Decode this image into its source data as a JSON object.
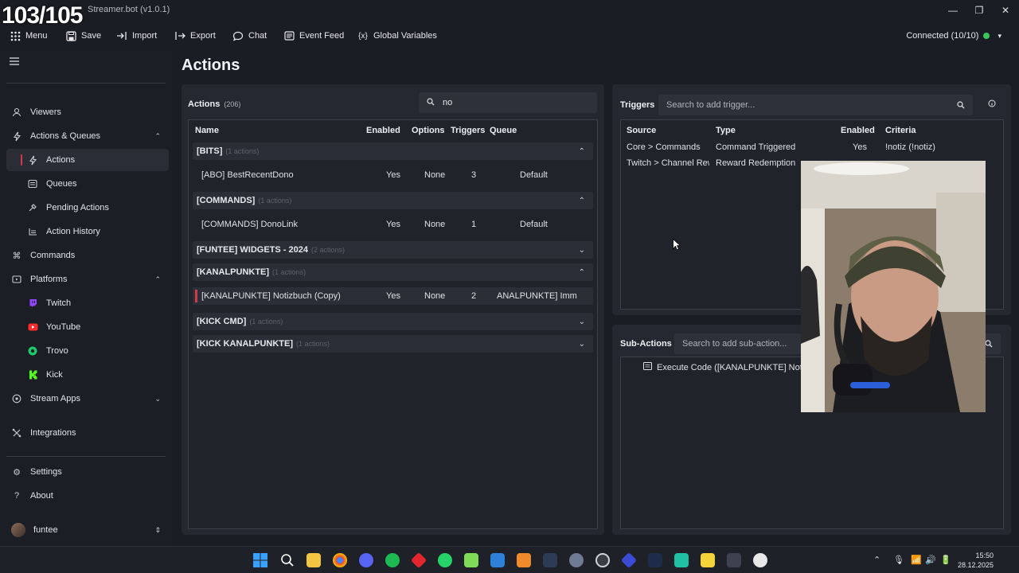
{
  "overlay_counter": "103/105",
  "window": {
    "title": "Streamer.bot (v1.0.1)",
    "minimize": "—",
    "maximize": "❐",
    "close": "✕"
  },
  "menubar": {
    "items": [
      {
        "label": "Menu",
        "icon": "grid-icon"
      },
      {
        "label": "Save",
        "icon": "save-icon"
      },
      {
        "label": "Import",
        "icon": "import-icon"
      },
      {
        "label": "Export",
        "icon": "export-icon"
      },
      {
        "label": "Chat",
        "icon": "chat-icon"
      },
      {
        "label": "Event Feed",
        "icon": "feed-icon"
      },
      {
        "label": "Global Variables",
        "icon": "variables-icon"
      }
    ],
    "connection": "Connected (10/10)",
    "status_color": "#3ac55b"
  },
  "sidebar": {
    "items": [
      {
        "label": "Viewers"
      },
      {
        "label": "Actions & Queues"
      },
      {
        "label": "Actions"
      },
      {
        "label": "Queues"
      },
      {
        "label": "Pending Actions"
      },
      {
        "label": "Action History"
      },
      {
        "label": "Commands"
      },
      {
        "label": "Platforms"
      },
      {
        "label": "Twitch"
      },
      {
        "label": "YouTube"
      },
      {
        "label": "Trovo"
      },
      {
        "label": "Kick"
      },
      {
        "label": "Stream Apps"
      },
      {
        "label": "Integrations"
      },
      {
        "label": "Settings"
      },
      {
        "label": "About"
      }
    ],
    "user": "funtee"
  },
  "page_title": "Actions",
  "actions_panel": {
    "title": "Actions",
    "count": "(206)",
    "search_value": "no",
    "columns": [
      "Name",
      "Enabled",
      "Options",
      "Triggers",
      "Queue"
    ],
    "groups": [
      {
        "name": "[BITS]",
        "count": "(1 actions)",
        "rows": [
          {
            "name": "[ABO] BestRecentDono",
            "enabled": "Yes",
            "options": "None",
            "triggers": "3",
            "queue": "Default"
          }
        ]
      },
      {
        "name": "[COMMANDS]",
        "count": "(1 actions)",
        "rows": [
          {
            "name": "[COMMANDS] DonoLink",
            "enabled": "Yes",
            "options": "None",
            "triggers": "1",
            "queue": "Default"
          }
        ]
      },
      {
        "name": "[FUNTEE] WIDGETS - 2024",
        "count": "(2 actions)",
        "rows": []
      },
      {
        "name": "[KANALPUNKTE]",
        "count": "(1 actions)",
        "rows": [
          {
            "name": "[KANALPUNKTE] Notizbuch (Copy)",
            "enabled": "Yes",
            "options": "None",
            "triggers": "2",
            "queue": "ANALPUNKTE] Imm"
          }
        ]
      },
      {
        "name": "[KICK CMD]",
        "count": "(1 actions)",
        "rows": []
      },
      {
        "name": "[KICK KANALPUNKTE]",
        "count": "(1 actions)",
        "rows": []
      }
    ]
  },
  "triggers_panel": {
    "title": "Triggers",
    "search_placeholder": "Search to add trigger...",
    "columns": [
      "Source",
      "Type",
      "Enabled",
      "Criteria"
    ],
    "rows": [
      {
        "source": "Core > Commands",
        "type": "Command Triggered",
        "enabled": "Yes",
        "criteria": "!notiz (!notiz)"
      },
      {
        "source": "Twitch > Channel Rewa",
        "type": "Reward Redemption",
        "enabled": "",
        "criteria": ""
      }
    ]
  },
  "subactions_panel": {
    "title": "Sub-Actions",
    "search_placeholder": "Search to add sub-action...",
    "items": [
      {
        "label": "Execute Code ([KANALPUNKTE] Notizbuch"
      }
    ]
  },
  "taskbar": {
    "time": "15:50",
    "date": "28.12.2025"
  },
  "colors": {
    "accent": "#d23a4c",
    "background": "#1b1d24",
    "panel": "#252830"
  }
}
